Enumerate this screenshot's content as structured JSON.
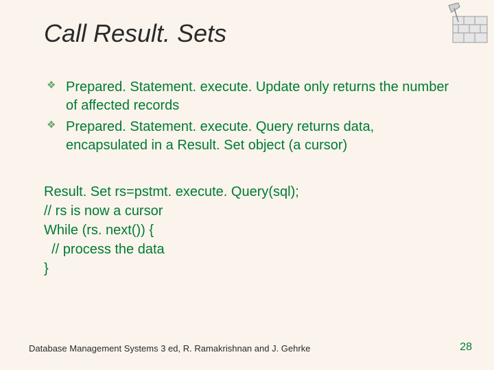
{
  "title": "Call Result. Sets",
  "bullets": [
    "Prepared. Statement. execute. Update only returns the number of affected records",
    "Prepared. Statement. execute. Query returns data, encapsulated in a Result. Set object (a cursor)"
  ],
  "code": [
    "Result. Set rs=pstmt. execute. Query(sql);",
    "// rs is now a cursor",
    "While (rs. next()) {",
    "  // process the data",
    "}"
  ],
  "footer": "Database Management Systems 3 ed, R. Ramakrishnan and J. Gehrke",
  "page": "28"
}
